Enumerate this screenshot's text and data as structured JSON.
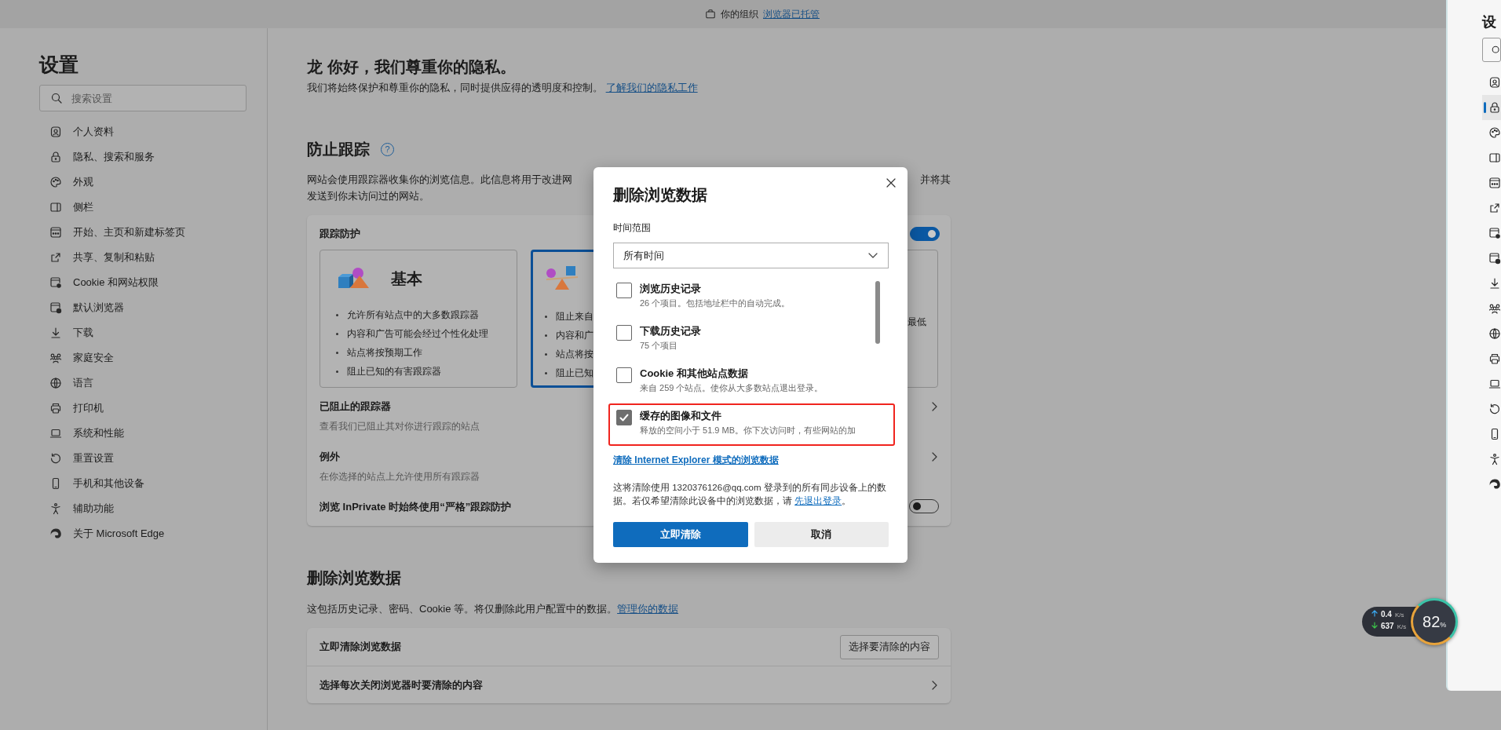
{
  "top_bar": {
    "text": "你的组织",
    "link": "浏览器已托管"
  },
  "sidebar": {
    "title": "设置",
    "search": {
      "placeholder": "搜索设置"
    },
    "items": [
      {
        "label": "个人资料"
      },
      {
        "label": "隐私、搜索和服务"
      },
      {
        "label": "外观"
      },
      {
        "label": "侧栏"
      },
      {
        "label": "开始、主页和新建标签页"
      },
      {
        "label": "共享、复制和粘贴"
      },
      {
        "label": "Cookie 和网站权限"
      },
      {
        "label": "默认浏览器"
      },
      {
        "label": "下载"
      },
      {
        "label": "家庭安全"
      },
      {
        "label": "语言"
      },
      {
        "label": "打印机"
      },
      {
        "label": "系统和性能"
      },
      {
        "label": "重置设置"
      },
      {
        "label": "手机和其他设备"
      },
      {
        "label": "辅助功能"
      },
      {
        "label": "关于 Microsoft Edge"
      }
    ]
  },
  "main": {
    "greeting": {
      "title": "龙 你好，我们尊重你的隐私。",
      "text": "我们将始终保护和尊重你的隐私，同时提供应得的透明度和控制。",
      "link": "了解我们的隐私工作"
    },
    "tracking": {
      "title": "防止跟踪",
      "help": "?",
      "description_left": "网站会使用跟踪器收集你的浏览信息。此信息将用于改进网",
      "description_right": "并将其",
      "description_line_2": "发送到你未访问过的网站。",
      "card": {
        "title": "跟踪防护",
        "on": true,
        "levels": [
          {
            "title": "基本",
            "selected": false,
            "items": [
              "允许所有站点中的大多数跟踪器",
              "内容和广告可能会经过个性化处理",
              "站点将按预期工作",
              "阻止已知的有害跟踪器"
            ]
          },
          {
            "selected": true,
            "items": [
              "阻止来自",
              "内容和广",
              "站点将按",
              "阻止已知"
            ]
          },
          {
            "selected": false,
            "items": [
              "最低"
            ]
          }
        ],
        "rows": [
          {
            "kind": "link",
            "title": "已阻止的跟踪器",
            "subtitle": "查看我们已阻止其对你进行跟踪的站点"
          },
          {
            "kind": "link",
            "title": "例外",
            "subtitle": "在你选择的站点上允许使用所有跟踪器"
          },
          {
            "kind": "toggle",
            "title": "浏览 InPrivate 时始终使用“严格”跟踪防护",
            "on": false
          }
        ]
      }
    },
    "clear_data": {
      "title": "删除浏览数据",
      "text": "这包括历史记录、密码、Cookie 等。将仅删除此用户配置中的数据。",
      "link": "管理你的数据",
      "rows": [
        {
          "kind": "button",
          "title": "立即清除浏览数据",
          "button": "选择要清除的内容"
        },
        {
          "kind": "link",
          "title": "选择每次关闭浏览器时要清除的内容"
        }
      ]
    }
  },
  "dialog": {
    "title": "删除浏览数据",
    "range_label": "时间范围",
    "range_value": "所有时间",
    "options": [
      {
        "title": "浏览历史记录",
        "subtitle": "26 个项目。包括地址栏中的自动完成。",
        "checked": false,
        "highlighted": false
      },
      {
        "title": "下载历史记录",
        "subtitle": "75 个项目",
        "checked": false,
        "highlighted": false
      },
      {
        "title": "Cookie 和其他站点数据",
        "subtitle": "来自 259 个站点。使你从大多数站点退出登录。",
        "checked": false,
        "highlighted": false
      },
      {
        "title": "缓存的图像和文件",
        "subtitle": "释放的空间小于 51.9 MB。你下次访问时，有些网站的加",
        "checked": true,
        "highlighted": true
      }
    ],
    "ie_link": "清除 Internet Explorer 模式的浏览数据",
    "info_before": "这将清除使用 1320376126@qq.com 登录到的所有同步设备上的数据。若仅希望清除此设备中的浏览数据，请 ",
    "info_link": "先退出登录",
    "info_after": "。",
    "primary_button": "立即清除",
    "secondary_button": "取消"
  },
  "right_window": {
    "title": "设",
    "items": [
      {
        "selected": false
      },
      {
        "selected": true
      },
      {
        "selected": false
      },
      {
        "selected": false
      },
      {
        "selected": false
      },
      {
        "selected": false
      },
      {
        "selected": false
      },
      {
        "selected": false
      },
      {
        "selected": false
      },
      {
        "selected": false
      },
      {
        "selected": false
      },
      {
        "selected": false
      },
      {
        "selected": false
      },
      {
        "selected": false
      },
      {
        "selected": false
      },
      {
        "selected": false
      },
      {
        "selected": false
      }
    ]
  },
  "net_widget": {
    "upload": "0.4",
    "upload_unit": "K/s",
    "download": "637",
    "download_unit": "K/s",
    "percent": "82",
    "percent_unit": "%"
  }
}
